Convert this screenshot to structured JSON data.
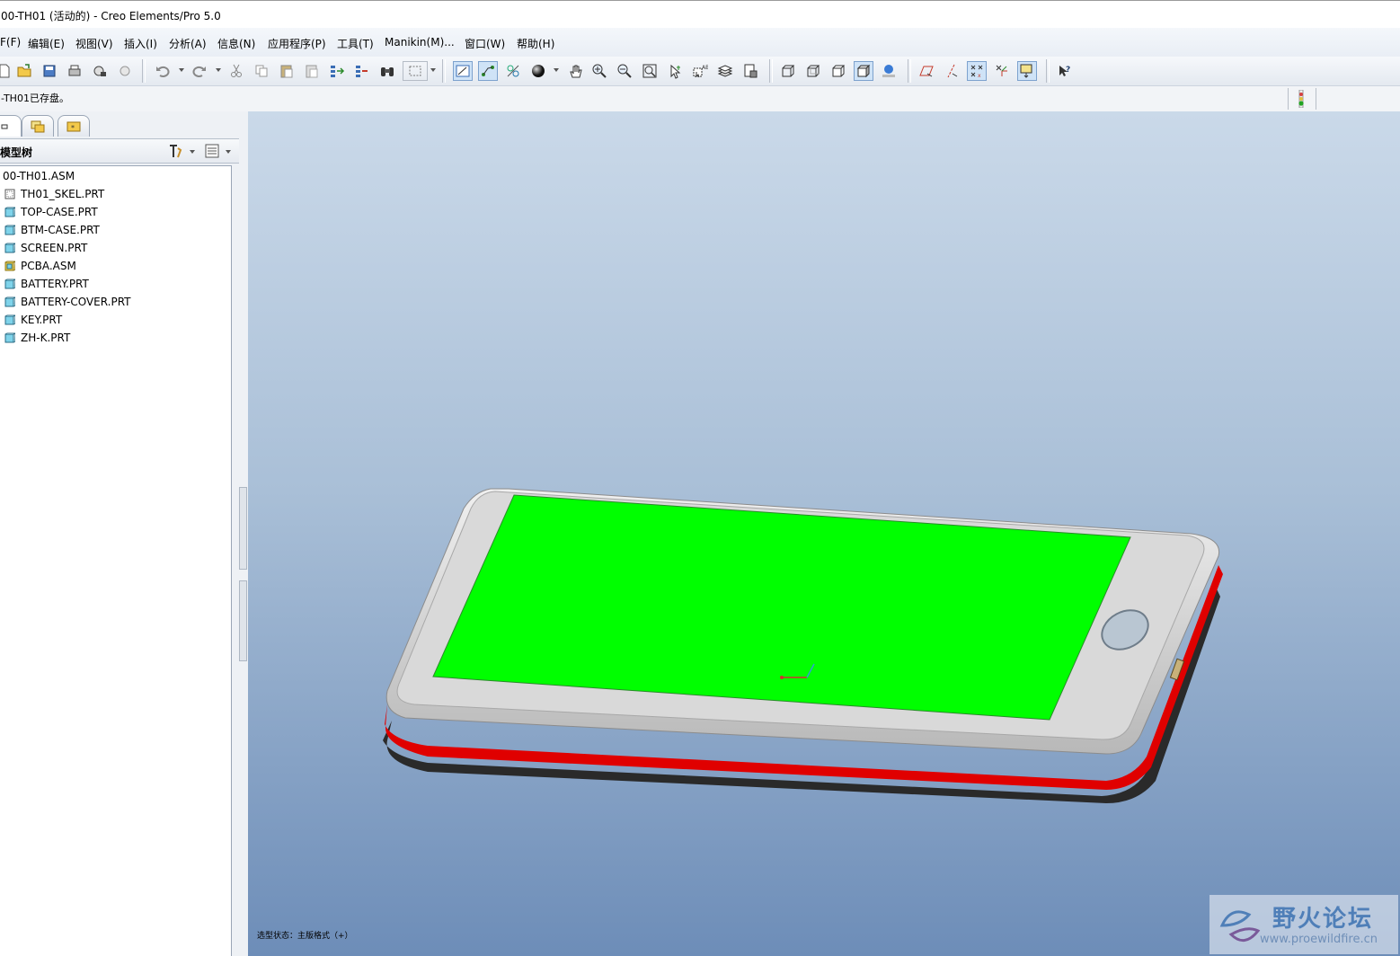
{
  "window": {
    "title": "00-TH01 (活动的) - Creo Elements/Pro 5.0"
  },
  "menu": [
    "F(F)",
    "编辑(E)",
    "视图(V)",
    "插入(I)",
    "分析(A)",
    "信息(N)",
    "应用程序(P)",
    "工具(T)",
    "Manikin(M)...",
    "窗口(W)",
    "帮助(H)"
  ],
  "message": "-TH01已存盘。",
  "navigator": {
    "panel_title": "模型树",
    "root": "00-TH01.ASM",
    "items": [
      {
        "label": "TH01_SKEL.PRT",
        "kind": "skeleton"
      },
      {
        "label": "TOP-CASE.PRT",
        "kind": "part"
      },
      {
        "label": "BTM-CASE.PRT",
        "kind": "part"
      },
      {
        "label": "SCREEN.PRT",
        "kind": "part"
      },
      {
        "label": "PCBA.ASM",
        "kind": "assembly"
      },
      {
        "label": "BATTERY.PRT",
        "kind": "part"
      },
      {
        "label": "BATTERY-COVER.PRT",
        "kind": "part"
      },
      {
        "label": "KEY.PRT",
        "kind": "part"
      },
      {
        "label": "ZH-K.PRT",
        "kind": "part"
      }
    ]
  },
  "viewport": {
    "status": "选型状态：主版格式（+）",
    "watermark_title": "野火论坛",
    "watermark_url": "www.proewildfire.cn"
  },
  "colors": {
    "screen": "#00ff00",
    "case": "#d8d8d8",
    "stripe": "#e00000",
    "base": "#2a2a2a"
  }
}
